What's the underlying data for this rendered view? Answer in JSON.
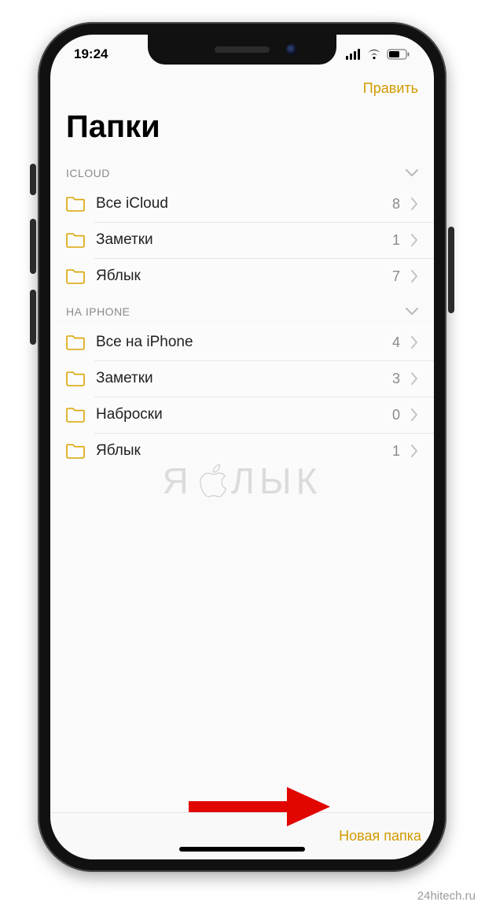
{
  "status": {
    "time": "19:24"
  },
  "nav": {
    "edit": "Править"
  },
  "title": "Папки",
  "sections": [
    {
      "header": "ICLOUD",
      "items": [
        {
          "label": "Все iCloud",
          "count": "8"
        },
        {
          "label": "Заметки",
          "count": "1"
        },
        {
          "label": "Яблык",
          "count": "7"
        }
      ]
    },
    {
      "header": "НА IPHONE",
      "items": [
        {
          "label": "Все на iPhone",
          "count": "4"
        },
        {
          "label": "Заметки",
          "count": "3"
        },
        {
          "label": "Наброски",
          "count": "0"
        },
        {
          "label": "Яблык",
          "count": "1"
        }
      ]
    }
  ],
  "toolbar": {
    "new_folder": "Новая папка"
  },
  "watermark": {
    "left": "Я",
    "right": "ЛЫК"
  },
  "attribution": "24hitech.ru"
}
